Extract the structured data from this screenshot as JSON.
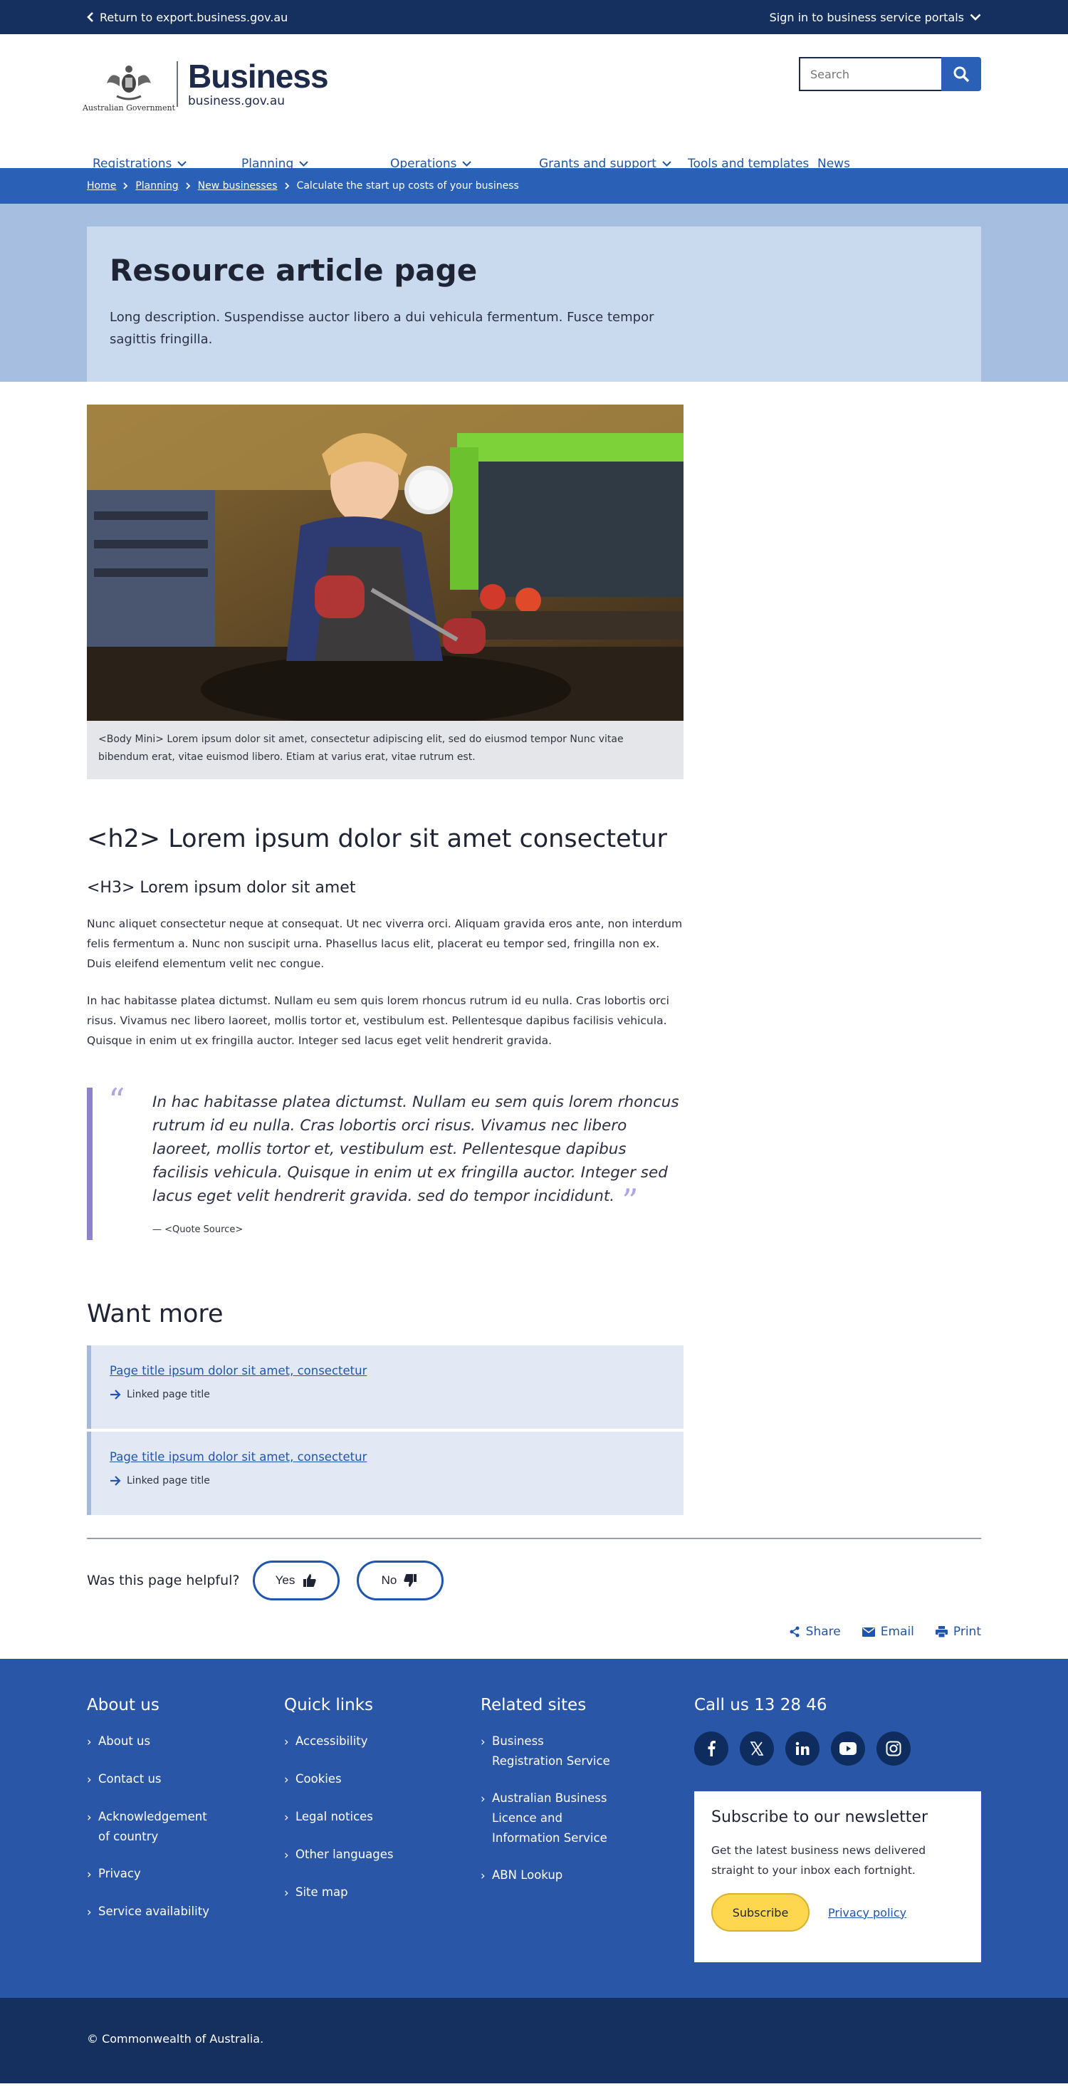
{
  "topbar": {
    "return_label": "Return to export.business.gov.au",
    "signin_label": "Sign in to business service portals"
  },
  "header": {
    "gov_label": "Australian Government",
    "brand_name": "Business",
    "brand_url": "business.gov.au",
    "search_placeholder": "Search"
  },
  "nav": {
    "items": [
      {
        "label": "Registrations",
        "has_dropdown": true
      },
      {
        "label": "Planning",
        "has_dropdown": true
      },
      {
        "label": "Operations",
        "has_dropdown": true
      },
      {
        "label": "Grants and support",
        "has_dropdown": true
      },
      {
        "label": "Tools and templates",
        "has_dropdown": false
      },
      {
        "label": "News",
        "has_dropdown": false
      }
    ]
  },
  "breadcrumb": {
    "items": [
      "Home",
      "Planning",
      "New businesses"
    ],
    "current": "Calculate the start up costs of your business"
  },
  "hero": {
    "title": "Resource article page",
    "description": "Long description. Suspendisse auctor libero a dui vehicula fermentum. Fusce tempor sagittis fringilla."
  },
  "figure": {
    "caption": "<Body Mini> Lorem ipsum dolor sit amet, consectetur adipiscing elit, sed do eiusmod tempor Nunc vitae bibendum erat, vitae euismod libero. Etiam at varius erat, vitae rutrum est."
  },
  "article": {
    "h2": "<h2> Lorem ipsum dolor sit amet consectetur",
    "h3": "<H3> Lorem ipsum dolor sit amet",
    "paragraphs": [
      "Nunc aliquet consectetur neque at consequat. Ut nec viverra orci. Aliquam gravida eros ante, non interdum felis fermentum a. Nunc non suscipit urna. Phasellus lacus elit, placerat eu tempor sed, fringilla non ex. Duis eleifend elementum velit nec congue.",
      "In hac habitasse platea dictumst. Nullam eu sem quis lorem rhoncus rutrum id eu nulla. Cras lobortis orci risus. Vivamus nec libero laoreet, mollis tortor et, vestibulum est. Pellentesque dapibus facilisis vehicula. Quisque in enim ut ex fringilla auctor. Integer sed lacus eget velit hendrerit gravida."
    ],
    "quote": {
      "text": "In hac habitasse platea dictumst. Nullam eu sem quis lorem rhoncus rutrum id eu nulla. Cras lobortis orci risus. Vivamus nec libero laoreet, mollis tortor et, vestibulum est. Pellentesque dapibus facilisis vehicula. Quisque in enim ut ex fringilla auctor. Integer sed lacus eget velit hendrerit gravida. sed do tempor incididunt.",
      "source": "— <Quote Source>"
    }
  },
  "want_more": {
    "title": "Want more",
    "cards": [
      {
        "title": "Page title ipsum dolor sit amet, consectetur",
        "sub": "Linked page title"
      },
      {
        "title": "Page title ipsum dolor sit amet, consectetur",
        "sub": "Linked page title"
      }
    ]
  },
  "feedback": {
    "question": "Was this page helpful?",
    "yes_label": "Yes",
    "no_label": "No"
  },
  "share": {
    "share_label": "Share",
    "email_label": "Email",
    "print_label": "Print"
  },
  "footer": {
    "about": {
      "title": "About us",
      "links": [
        "About us",
        "Contact us",
        "Acknowledgement of country",
        "Privacy",
        "Service availability"
      ]
    },
    "quick": {
      "title": "Quick links",
      "links": [
        "Accessibility",
        "Cookies",
        "Legal notices",
        "Other languages",
        "Site map"
      ]
    },
    "related": {
      "title": "Related sites",
      "links": [
        "Business Registration Service",
        "Australian Business Licence and Information Service",
        "ABN Lookup"
      ]
    },
    "call": {
      "title": "Call us 13 28 46",
      "socials": [
        "facebook-icon",
        "x-icon",
        "linkedin-icon",
        "youtube-icon",
        "instagram-icon"
      ]
    },
    "newsletter": {
      "title": "Subscribe to our newsletter",
      "description": "Get the latest business news delivered straight to your inbox each fortnight.",
      "subscribe_label": "Subscribe",
      "privacy_label": "Privacy policy"
    },
    "copyright": "© Commonwealth of Australia."
  },
  "colors": {
    "topbar": "#15305f",
    "primary": "#2a61b6",
    "link": "#2055ab",
    "hero_bg": "#a6bfe0",
    "hero_box": "#c9d9ee",
    "quote_accent": "#8d82cf",
    "footer": "#2a56a8",
    "subscribe": "#ffd74f"
  }
}
